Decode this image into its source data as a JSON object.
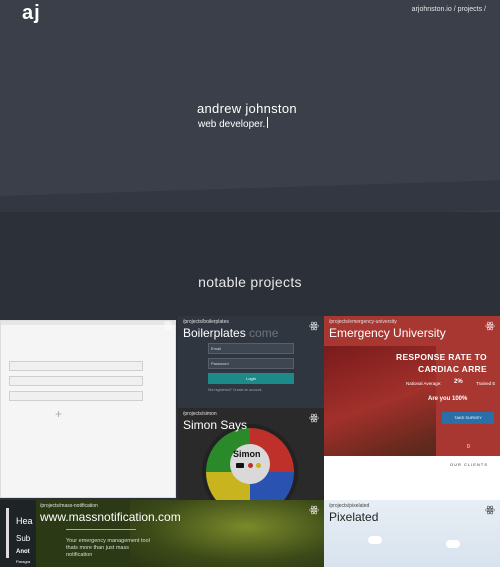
{
  "header": {
    "logo": "aj",
    "breadcrumb": "arjohnston.io / projects /"
  },
  "hero": {
    "name": "andrew johnston",
    "role": "web developer."
  },
  "section": {
    "title": "notable projects"
  },
  "projects": [
    {
      "path": "",
      "title": ""
    },
    {
      "path": "/projects/boilerplates",
      "title": "Boilerplates",
      "title_ghost": "come",
      "email_placeholder": "Email",
      "password_placeholder": "Password",
      "login_label": "Login",
      "register_text": "Not registered? Create an account"
    },
    {
      "path": "/projects/simon",
      "title": "Simon Says",
      "logo_text": "Simon"
    },
    {
      "path": "/projects/emergency-university",
      "title": "Emergency University",
      "headline_1": "RESPONSE RATE TO",
      "headline_2": "CARDIAC ARRE",
      "national_label": "National Average:",
      "national_value": "2%",
      "trained_label": "Trained E",
      "question": "Are you 100%",
      "survey_label": "TAKE SURVEY",
      "counter": "0",
      "clients_label": "OUR CLIENTS"
    },
    {
      "path": "/projects/mass-notification",
      "title": "www.massnotification.com",
      "description": "Your emergency management tool thats more than just mass notification",
      "side_1": "Hea",
      "side_2": "Sub",
      "side_3": "Anot",
      "side_4": "Paragra"
    },
    {
      "path": "/projects/pixelated",
      "title": "Pixelated"
    }
  ],
  "colors": {
    "hero_bg": "#3a3f49",
    "page_bg": "#2b3039",
    "eu_red": "#b8433c",
    "accent_teal": "#1d8a8a"
  },
  "icons": {
    "tile_badge": "react-icon"
  }
}
